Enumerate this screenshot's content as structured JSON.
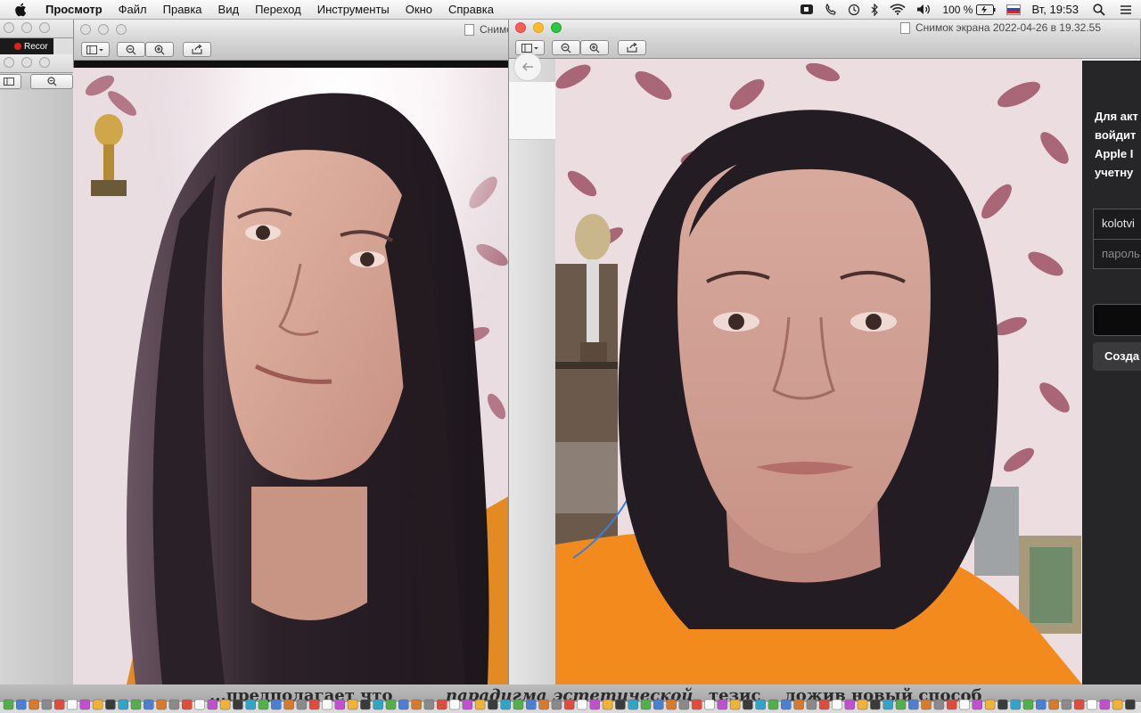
{
  "menubar": {
    "app_name": "Просмотр",
    "items": [
      "Файл",
      "Правка",
      "Вид",
      "Переход",
      "Инструменты",
      "Окно",
      "Справка"
    ],
    "battery": "100 %",
    "clock": "Вт, 19:53"
  },
  "background_windows": {
    "record_label": "Recor",
    "middle_window_title": "Снимо"
  },
  "front_window": {
    "title": "Снимок экрана 2022-04-26 в 19.32.55"
  },
  "signin_panel": {
    "text_lines": [
      "Для акт",
      "войдит",
      "Apple I",
      "учетну"
    ],
    "username_value": "kolotvi",
    "password_placeholder": "пароль",
    "create_button": "Созда"
  },
  "dock": {
    "background_text_left": "...предполагает что",
    "background_text_center": "парадигма эстетической",
    "background_text_right": "ложив новый способ",
    "small_text": "тезис"
  },
  "colors": {
    "sweater": "#f28a1e",
    "wallpaper": "#ecdde0",
    "leaf": "#a86677",
    "panel": "#262628",
    "hair": "#231c22"
  },
  "icons": [
    "apple-icon",
    "facetime-icon",
    "bluetooth-icon",
    "wifi-icon",
    "volume-icon",
    "battery-icon",
    "russian-flag-icon",
    "search-icon",
    "list-icon",
    "back-icon"
  ]
}
